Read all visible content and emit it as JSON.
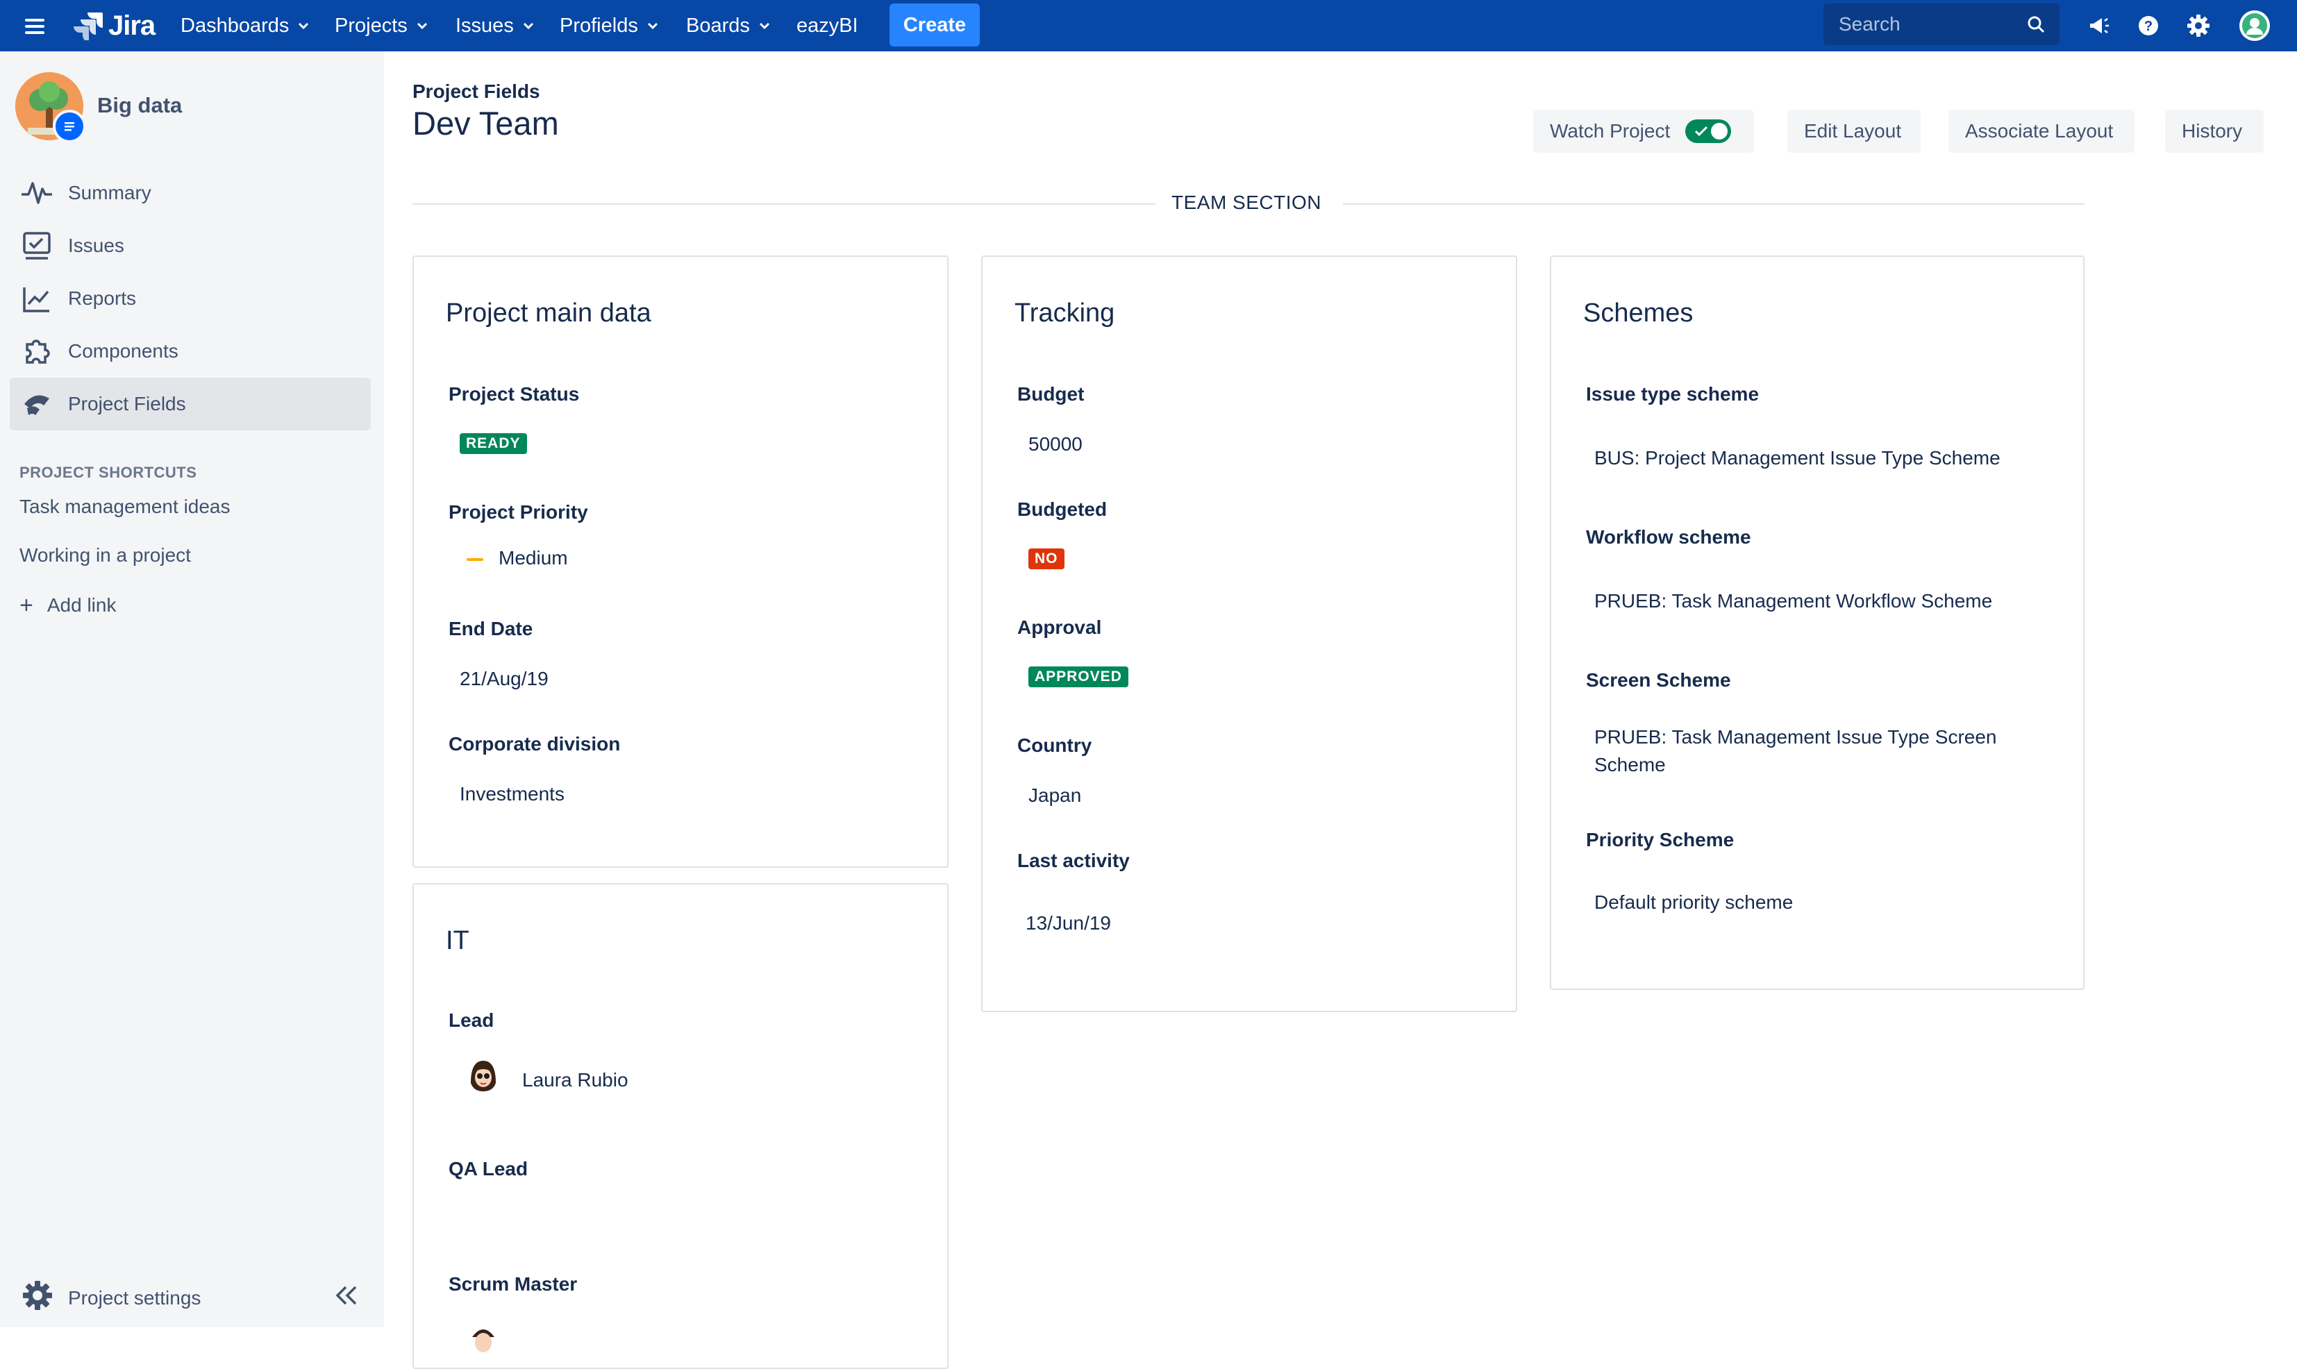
{
  "nav": {
    "logo_text": "Jira",
    "items": [
      {
        "label": "Dashboards"
      },
      {
        "label": "Projects"
      },
      {
        "label": "Issues"
      },
      {
        "label": "Profields"
      },
      {
        "label": "Boards"
      },
      {
        "label": "eazyBI"
      }
    ],
    "create_label": "Create",
    "search_placeholder": "Search"
  },
  "sidebar": {
    "project_name": "Big data",
    "items": [
      {
        "label": "Summary",
        "icon": "activity-icon"
      },
      {
        "label": "Issues",
        "icon": "issues-icon"
      },
      {
        "label": "Reports",
        "icon": "reports-icon"
      },
      {
        "label": "Components",
        "icon": "components-icon"
      },
      {
        "label": "Project Fields",
        "icon": "project-fields-icon",
        "active": true
      }
    ],
    "shortcuts_title": "PROJECT SHORTCUTS",
    "shortcuts": [
      "Task management ideas",
      "Working in a project"
    ],
    "add_link_label": "Add link",
    "settings_label": "Project settings"
  },
  "page": {
    "breadcrumb": "Project Fields",
    "title": "Dev Team",
    "actions": {
      "watch": "Watch Project",
      "watch_enabled": true,
      "edit_layout": "Edit Layout",
      "associate_layout": "Associate Layout",
      "history": "History"
    },
    "section_title": "TEAM SECTION"
  },
  "cards": {
    "main": {
      "title": "Project main data",
      "status_label": "Project Status",
      "status_value": "READY",
      "status_color": "#00875A",
      "priority_label": "Project Priority",
      "priority_value": "Medium",
      "priority_color": "#FFAB00",
      "end_date_label": "End Date",
      "end_date_value": "21/Aug/19",
      "division_label": "Corporate division",
      "division_value": "Investments"
    },
    "tracking": {
      "title": "Tracking",
      "budget_label": "Budget",
      "budget_value": "50000",
      "budgeted_label": "Budgeted",
      "budgeted_value": "NO",
      "budgeted_color": "#DE350B",
      "approval_label": "Approval",
      "approval_value": "APPROVED",
      "approval_color": "#00875A",
      "country_label": "Country",
      "country_value": "Japan",
      "last_activity_label": "Last activity",
      "last_activity_value": "13/Jun/19"
    },
    "schemes": {
      "title": "Schemes",
      "issue_type_label": "Issue type scheme",
      "issue_type_value": "BUS: Project Management Issue Type Scheme",
      "workflow_label": "Workflow scheme",
      "workflow_value": "PRUEB: Task Management Workflow Scheme",
      "screen_label": "Screen Scheme",
      "screen_value": "PRUEB: Task Management Issue Type Screen Scheme",
      "priority_label": "Priority Scheme",
      "priority_value": "Default priority scheme"
    },
    "it": {
      "title": "IT",
      "lead_label": "Lead",
      "lead_value": "Laura Rubio",
      "qa_lead_label": "QA Lead",
      "scrum_master_label": "Scrum Master"
    }
  }
}
